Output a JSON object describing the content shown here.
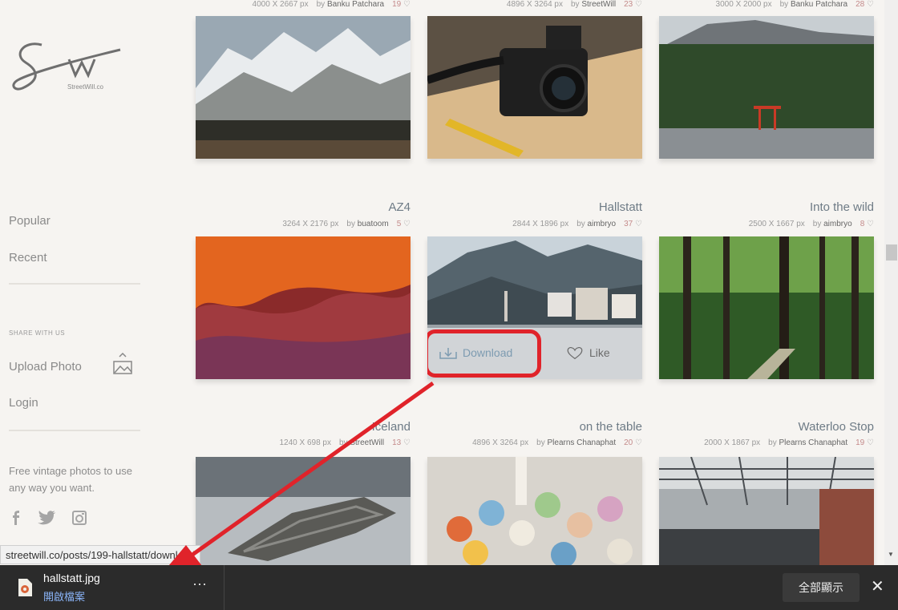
{
  "logo": {
    "script": "Sw",
    "subtitle": "StreetWill.co"
  },
  "sidebar": {
    "nav": [
      {
        "label": "Popular"
      },
      {
        "label": "Recent"
      }
    ],
    "share_label": "SHARE WITH US",
    "actions": [
      {
        "label": "Upload Photo"
      },
      {
        "label": "Login"
      }
    ],
    "tagline": "Free vintage photos to use any way you want.",
    "social": [
      "facebook-icon",
      "twitter-icon",
      "instagram-icon"
    ]
  },
  "rows": [
    [
      {
        "title": "",
        "size": "4000 X 2667 px",
        "by": "by",
        "author": "Banku Patchara",
        "likes": "19"
      },
      {
        "title": "",
        "size": "4896 X 3264 px",
        "by": "by",
        "author": "StreetWill",
        "likes": "23"
      },
      {
        "title": "",
        "size": "3000 X 2000 px",
        "by": "by",
        "author": "Banku Patchara",
        "likes": "28"
      }
    ],
    [
      {
        "title": "AZ4",
        "size": "3264 X 2176 px",
        "by": "by",
        "author": "buatoom",
        "likes": "5"
      },
      {
        "title": "Hallstatt",
        "size": "2844 X 1896 px",
        "by": "by",
        "author": "aimbryo",
        "likes": "37"
      },
      {
        "title": "Into the wild",
        "size": "2500 X 1667 px",
        "by": "by",
        "author": "aimbryo",
        "likes": "8"
      }
    ],
    [
      {
        "title": "Iceland",
        "size": "1240 X 698 px",
        "by": "by",
        "author": "StreetWill",
        "likes": "13"
      },
      {
        "title": "on the table",
        "size": "4896 X 3264 px",
        "by": "by",
        "author": "Plearns Chanaphat",
        "likes": "20"
      },
      {
        "title": "Waterloo Stop",
        "size": "2000 X 1867 px",
        "by": "by",
        "author": "Plearns Chanaphat",
        "likes": "19"
      }
    ]
  ],
  "hover": {
    "download": "Download",
    "like": "Like"
  },
  "status_url": "streetwill.co/posts/199-hallstatt/download",
  "download_bar": {
    "file_name": "hallstatt.jpg",
    "open_label": "開啟檔案",
    "more": "⋯",
    "show_all": "全部顯示",
    "close": "✕"
  },
  "colors": {
    "highlight": "#e0232a",
    "accent_link": "#7d9bb1"
  }
}
